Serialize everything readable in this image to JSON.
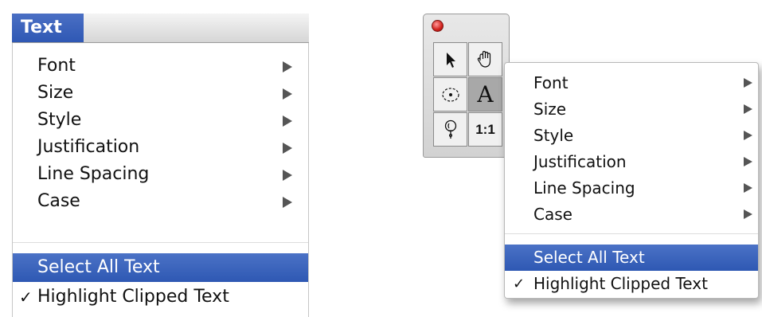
{
  "left_menu": {
    "title": "Text",
    "items": [
      {
        "label": "Font",
        "has_submenu": true
      },
      {
        "label": "Size",
        "has_submenu": true
      },
      {
        "label": "Style",
        "has_submenu": true
      },
      {
        "label": "Justification",
        "has_submenu": true
      },
      {
        "label": "Line Spacing",
        "has_submenu": true
      },
      {
        "label": "Case",
        "has_submenu": true
      }
    ],
    "select_all": "Select All Text",
    "highlight_clipped": "Highlight Clipped Text",
    "check_mark": "✓"
  },
  "palette": {
    "tools": [
      {
        "icon": "arrow-pointer-icon"
      },
      {
        "icon": "hand-icon"
      },
      {
        "icon": "circle-dot-icon"
      },
      {
        "icon": "text-a-icon",
        "label": "A",
        "active": true
      },
      {
        "icon": "pushpin-icon"
      },
      {
        "icon": "ratio-icon",
        "label": "1:1"
      }
    ]
  },
  "right_menu": {
    "items": [
      {
        "label": "Font",
        "has_submenu": true
      },
      {
        "label": "Size",
        "has_submenu": true
      },
      {
        "label": "Style",
        "has_submenu": true
      },
      {
        "label": "Justification",
        "has_submenu": true
      },
      {
        "label": "Line Spacing",
        "has_submenu": true
      },
      {
        "label": "Case",
        "has_submenu": true
      }
    ],
    "select_all": "Select All Text",
    "highlight_clipped": "Highlight Clipped Text",
    "check_mark": "✓"
  },
  "colors": {
    "selection": "#3a62bd",
    "close_button": "#d0201a"
  }
}
